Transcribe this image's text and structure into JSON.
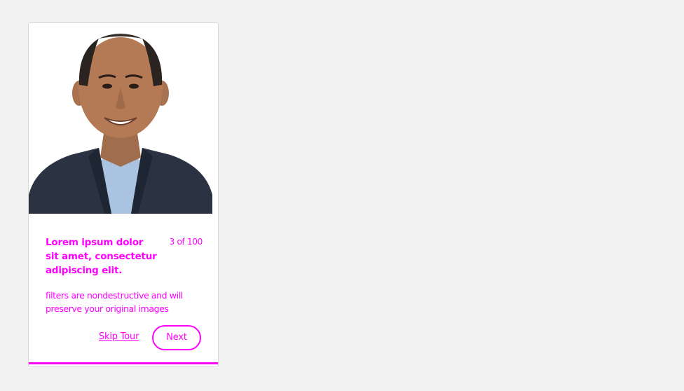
{
  "tour": {
    "title": "Lorem ipsum dolor sit amet, consectetur adipiscing elit.",
    "counter": "3 of 100",
    "description": "filters are nondestructive and will preserve your original images",
    "skip_label": "Skip Tour",
    "next_label": "Next"
  },
  "colors": {
    "accent": "#ff00ff",
    "page_background": "#f2f2f2",
    "card_background": "#ffffff"
  }
}
